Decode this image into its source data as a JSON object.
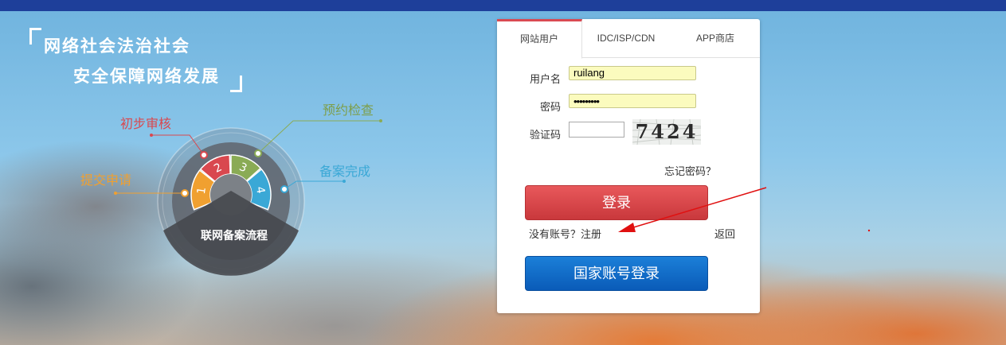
{
  "slogan": {
    "line1": "网络社会法治社会",
    "line2": "安全保障网络发展"
  },
  "flow": {
    "center_label": "联网备案流程",
    "steps": [
      {
        "num": "1",
        "label": "提交申请",
        "color": "#f0a030"
      },
      {
        "num": "2",
        "label": "初步审核",
        "color": "#d9484f"
      },
      {
        "num": "3",
        "label": "预约检查",
        "color": "#8aab55"
      },
      {
        "num": "4",
        "label": "备案完成",
        "color": "#3aa8d6"
      }
    ]
  },
  "login": {
    "tabs": [
      "网站用户",
      "IDC/ISP/CDN",
      "APP商店"
    ],
    "active_tab": "网站用户",
    "username_label": "用户名",
    "username_value": "ruilang",
    "password_label": "密码",
    "password_value": "•••••••••",
    "captcha_label": "验证码",
    "captcha_value": "",
    "captcha_text": "7424",
    "forgot": "忘记密码？",
    "login_button": "登录",
    "register": "没有账号？注册",
    "back": "返回",
    "gov_button": "国家账号登录"
  },
  "colors": {
    "topbar": "#1e3f9a",
    "login_button": "#d9484f",
    "gov_button": "#0a6ccf",
    "annotation_arrow": "#e01010"
  }
}
